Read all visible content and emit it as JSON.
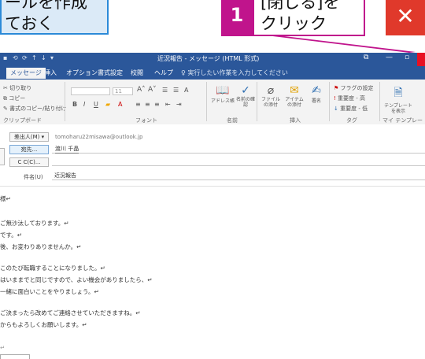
{
  "annotations": {
    "left_callout": {
      "line1": "ールを作成",
      "line2": "ておく"
    },
    "step": {
      "number": "1",
      "line1": "[閉じる]を",
      "line2": "クリック"
    },
    "close_glyph": "✕"
  },
  "titlebar": {
    "title": "近況報告 - メッセージ (HTML 形式)",
    "quick_access": [
      "⟲",
      "⟳",
      "↑",
      "↓",
      "▾"
    ],
    "window_buttons": [
      "⧉",
      "—",
      "▫"
    ]
  },
  "tabs": [
    {
      "label": "メッセージ",
      "active": true
    },
    {
      "label": "挿入"
    },
    {
      "label": "オプション"
    },
    {
      "label": "書式設定"
    },
    {
      "label": "校閲"
    },
    {
      "label": "ヘルプ"
    },
    {
      "label": "実行したい作業を入力してください"
    }
  ],
  "ribbon": {
    "clipboard": {
      "cut": "切り取り",
      "copy": "コピー",
      "format_painter": "書式のコピー/貼り付け",
      "label": "クリップボード"
    },
    "font": {
      "size": "11",
      "label": "フォント",
      "buttons": [
        "B",
        "I",
        "U",
        "A"
      ]
    },
    "names": {
      "address_book": "アドレス帳",
      "check_names": "名前の確認",
      "label": "名前"
    },
    "include": {
      "attach_file": "ファイルの添付",
      "attach_item": "アイテムの添付",
      "signature": "署名",
      "label": "挿入"
    },
    "tags": {
      "follow_up": "フラグの設定",
      "high": "重要度 - 高",
      "low": "重要度 - 低",
      "label": "タグ"
    },
    "templates": {
      "view": "テンプレートを表示",
      "label": "マイ テンプレート"
    }
  },
  "header": {
    "from_label": "差出人(M) ▾",
    "from_value": "tomoharu22misawa@outlook.jp",
    "to_label": "宛先...",
    "to_value": "渡川 千晶",
    "cc_label": "C C(C)...",
    "subject_label": "件名(U)",
    "subject_value": "近況報告"
  },
  "body": {
    "lines": [
      "様↵",
      "",
      "ご無沙汰しております。↵",
      "です。↵",
      "後、お変わりありませんか。↵",
      "",
      "このたび転職することになりました。↵",
      "はいままでと同じですので、よい機会がありましたら、↵",
      "一緒に面白いことをやりましょう。↵",
      "",
      "ご決まったら改めてご連絡させていただきますね。↵",
      "からもよろしくお願いします。↵",
      "",
      "↵"
    ]
  }
}
